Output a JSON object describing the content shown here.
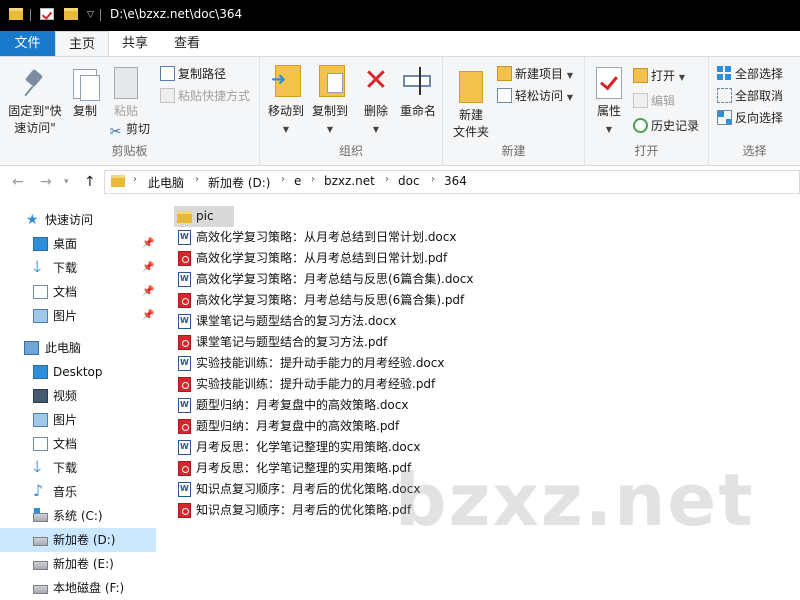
{
  "window": {
    "path": "D:\\e\\bzxz.net\\doc\\364"
  },
  "tabs": {
    "file": "文件",
    "home": "主页",
    "share": "共享",
    "view": "查看"
  },
  "ribbon": {
    "clipboard": {
      "title": "剪贴板",
      "pin_line1": "固定到\"快",
      "pin_line2": "速访问\"",
      "copy": "复制",
      "paste": "粘贴",
      "copy_path": "复制路径",
      "paste_shortcut": "粘贴快捷方式",
      "cut": "剪切"
    },
    "organize": {
      "title": "组织",
      "move_to": "移动到",
      "copy_to": "复制到",
      "delete": "删除",
      "rename": "重命名"
    },
    "new": {
      "title": "新建",
      "new_folder_line1": "新建",
      "new_folder_line2": "文件夹",
      "new_item": "新建项目",
      "easy_access": "轻松访问"
    },
    "open": {
      "title": "打开",
      "properties": "属性",
      "open": "打开",
      "edit": "编辑",
      "history": "历史记录"
    },
    "select": {
      "title": "选择",
      "select_all": "全部选择",
      "select_none": "全部取消",
      "invert": "反向选择"
    }
  },
  "address": {
    "crumbs": [
      "此电脑",
      "新加卷 (D:)",
      "e",
      "bzxz.net",
      "doc",
      "364"
    ]
  },
  "nav": {
    "quick_access": "快速访问",
    "qa_items": [
      "桌面",
      "下载",
      "文档",
      "图片"
    ],
    "this_pc": "此电脑",
    "pc_items": [
      "Desktop",
      "视频",
      "图片",
      "文档",
      "下载",
      "音乐",
      "系统 (C:)",
      "新加卷 (D:)",
      "新加卷 (E:)",
      "本地磁盘 (F:)"
    ]
  },
  "files": [
    {
      "name": "pic",
      "type": "folder"
    },
    {
      "name": "高效化学复习策略：从月考总结到日常计划.docx",
      "type": "docx"
    },
    {
      "name": "高效化学复习策略：从月考总结到日常计划.pdf",
      "type": "pdf"
    },
    {
      "name": "高效化学复习策略：月考总结与反思(6篇合集).docx",
      "type": "docx"
    },
    {
      "name": "高效化学复习策略：月考总结与反思(6篇合集).pdf",
      "type": "pdf"
    },
    {
      "name": "课堂笔记与题型结合的复习方法.docx",
      "type": "docx"
    },
    {
      "name": "课堂笔记与题型结合的复习方法.pdf",
      "type": "pdf"
    },
    {
      "name": "实验技能训练：提升动手能力的月考经验.docx",
      "type": "docx"
    },
    {
      "name": "实验技能训练：提升动手能力的月考经验.pdf",
      "type": "pdf"
    },
    {
      "name": "题型归纳：月考复盘中的高效策略.docx",
      "type": "docx"
    },
    {
      "name": "题型归纳：月考复盘中的高效策略.pdf",
      "type": "pdf"
    },
    {
      "name": "月考反思：化学笔记整理的实用策略.docx",
      "type": "docx"
    },
    {
      "name": "月考反思：化学笔记整理的实用策略.pdf",
      "type": "pdf"
    },
    {
      "name": "知识点复习顺序：月考后的优化策略.docx",
      "type": "docx"
    },
    {
      "name": "知识点复习顺序：月考后的优化策略.pdf",
      "type": "pdf"
    }
  ],
  "watermark": "bzxz.net",
  "colors": {
    "file_tab": "#1979ca",
    "selected_nav": "#cce8ff",
    "delete_red": "#d7262a",
    "folder_yellow": "#e8b83a"
  }
}
